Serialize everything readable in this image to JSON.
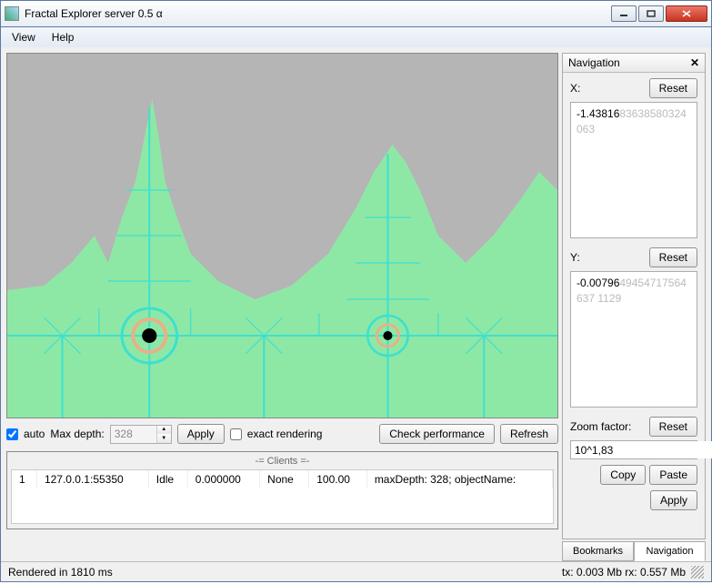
{
  "window": {
    "title": "Fractal Explorer server  0.5 α"
  },
  "menu": {
    "view": "View",
    "help": "Help"
  },
  "controls": {
    "auto_label": "auto",
    "maxdepth_label": "Max depth:",
    "maxdepth_value": "328",
    "apply": "Apply",
    "exact_label": "exact rendering",
    "checkperf": "Check performance",
    "refresh": "Refresh"
  },
  "clients": {
    "title": "-= Clients =-",
    "row": {
      "idx": "1",
      "addr": "127.0.0.1:55350",
      "state": "Idle",
      "val1": "0.000000",
      "val2": "None",
      "val3": "100.00",
      "info": "maxDepth: 328; objectName:"
    }
  },
  "nav": {
    "title": "Navigation",
    "x_label": "X:",
    "y_label": "Y:",
    "reset": "Reset",
    "x_typed": "-1.43816",
    "x_faded": "83638580324063",
    "y_typed": "-0.00796",
    "y_faded": "49454717564637 1129",
    "zoom_label": "Zoom factor:",
    "zoom_value": "10^1,83",
    "copy": "Copy",
    "paste": "Paste",
    "apply": "Apply"
  },
  "tabs": {
    "bookmarks": "Bookmarks",
    "navigation": "Navigation"
  },
  "status": {
    "left": "Rendered in 1810 ms",
    "right": "tx: 0.003 Mb rx: 0.557 Mb"
  }
}
